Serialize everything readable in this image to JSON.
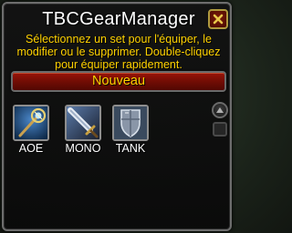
{
  "window": {
    "title": "TBCGearManager",
    "close_icon": "close-icon",
    "description": "Sélectionnez un set pour l'équiper, le modifier ou le supprimer. Double-cliquez pour équiper rapidement.",
    "new_button_label": "Nouveau"
  },
  "sets": [
    {
      "label": "AOE",
      "icon": "staff-icon"
    },
    {
      "label": "MONO",
      "icon": "sword-icon"
    },
    {
      "label": "TANK",
      "icon": "shield-icon"
    }
  ],
  "colors": {
    "title": "#ffffff",
    "description": "#ffd200",
    "button_text": "#ffd200",
    "button_bg": "#8a1206",
    "close_bg": "#6a1405",
    "frame_border": "#6d6d6d"
  }
}
